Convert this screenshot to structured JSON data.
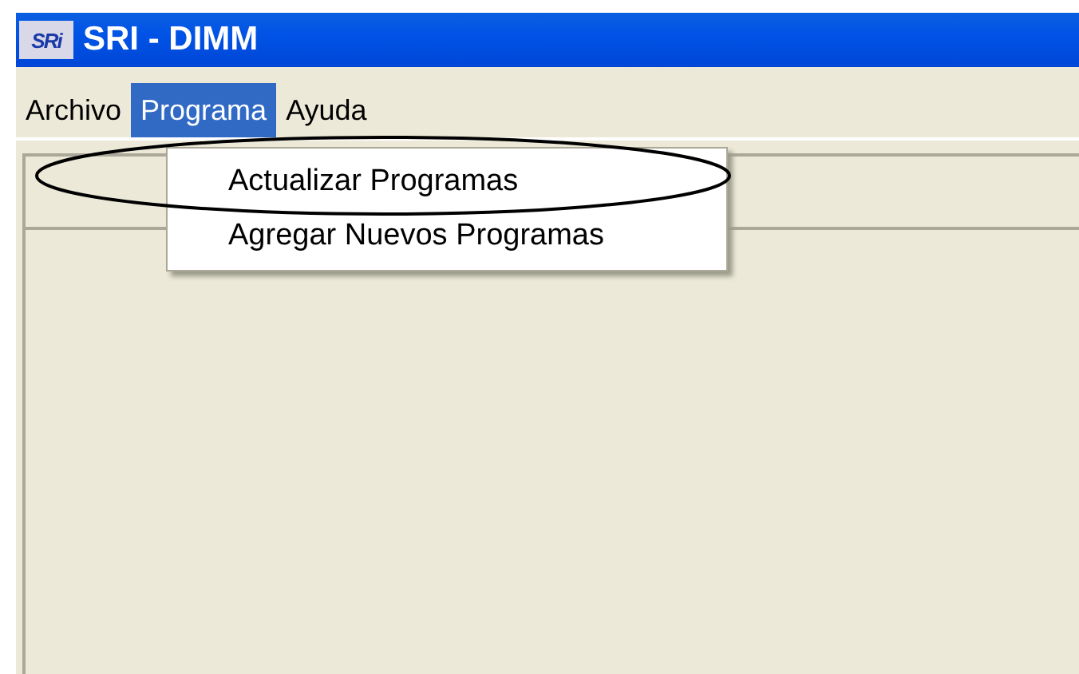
{
  "window": {
    "logo": "SRi",
    "title": "SRI - DIMM"
  },
  "menu": [
    {
      "label": "Archivo",
      "selected": false
    },
    {
      "label": "Programa",
      "selected": true
    },
    {
      "label": "Ayuda",
      "selected": false
    }
  ],
  "dropdown": {
    "items": [
      "Actualizar Programas",
      "Agregar Nuevos Programas"
    ]
  }
}
